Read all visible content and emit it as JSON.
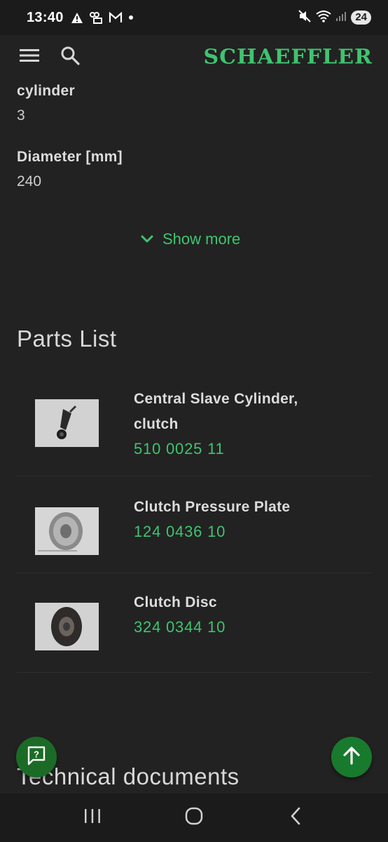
{
  "status_bar": {
    "time": "13:40",
    "battery": "24",
    "icons": [
      "warning-icon",
      "voicemail-icon",
      "gmail-icon",
      "dot-icon",
      "mute-icon",
      "wifi-icon",
      "signal-icon"
    ]
  },
  "app_bar": {
    "brand": "SCHAEFFLER",
    "brand_color": "#3fc46f",
    "icons": [
      "menu-icon",
      "search-icon"
    ]
  },
  "specs": [
    {
      "label": "cylinder",
      "value": "3"
    },
    {
      "label": "Diameter [mm]",
      "value": "240"
    }
  ],
  "show_more_label": "Show more",
  "parts_list": {
    "title": "Parts List",
    "items": [
      {
        "name_line1": "Central Slave Cylinder,",
        "name_line2": "clutch",
        "number": "510 0025 11"
      },
      {
        "name_line1": "Clutch Pressure Plate",
        "number": "124 0436 10"
      },
      {
        "name_line1": "Clutch Disc",
        "number": "324 0344 10"
      }
    ]
  },
  "technical_documents_title": "Technical documents",
  "accent_color": "#3fc46f",
  "nav_bar": {
    "icons": [
      "recent-apps-icon",
      "home-icon",
      "back-icon"
    ]
  }
}
